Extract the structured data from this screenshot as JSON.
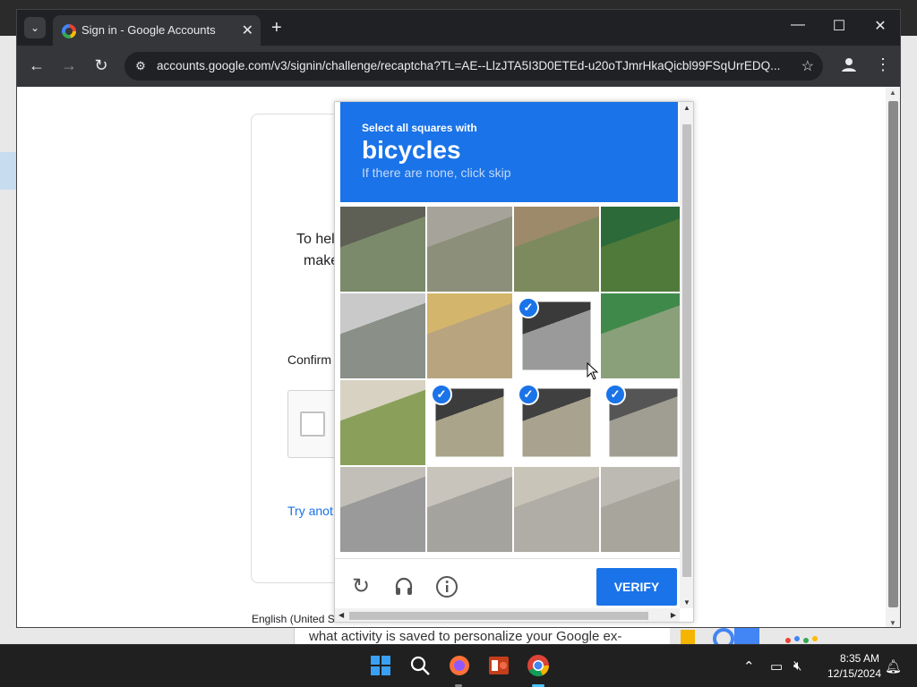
{
  "browser": {
    "tab_title": "Sign in - Google Accounts",
    "url": "accounts.google.com/v3/signin/challenge/recaptcha?TL=AE--LlzJTA5I3D0ETEd-u20oTJmrHkaQicbl99FSqUrrEDQ...",
    "new_tab_symbol": "+",
    "tab_close_symbol": "✕",
    "window_controls": {
      "minimize": "—",
      "maximize": "☐",
      "close": "✕"
    }
  },
  "background_page": {
    "text_line1": "To hel",
    "text_line2": "make",
    "confirm_text": "Confirm",
    "try_another": "Try anot",
    "language": "English (United S",
    "behind_text": "what activity is saved to personalize your Google ex-"
  },
  "captcha": {
    "instruction": "Select all squares with",
    "target": "bicycles",
    "hint": "If there are none, click skip",
    "verify_label": "VERIFY",
    "tiles": [
      {
        "selected": false
      },
      {
        "selected": false
      },
      {
        "selected": false
      },
      {
        "selected": false
      },
      {
        "selected": false
      },
      {
        "selected": false
      },
      {
        "selected": true
      },
      {
        "selected": false
      },
      {
        "selected": false
      },
      {
        "selected": true
      },
      {
        "selected": true
      },
      {
        "selected": true
      },
      {
        "selected": false
      },
      {
        "selected": false
      },
      {
        "selected": false
      },
      {
        "selected": false
      }
    ],
    "icons": [
      "reload-icon",
      "headphones-icon",
      "info-icon"
    ],
    "accent_color": "#1a73e8"
  },
  "taskbar": {
    "apps": [
      "windows-start",
      "search",
      "firefox",
      "powerpoint",
      "chrome"
    ],
    "time": "8:35 AM",
    "date": "12/15/2024"
  }
}
